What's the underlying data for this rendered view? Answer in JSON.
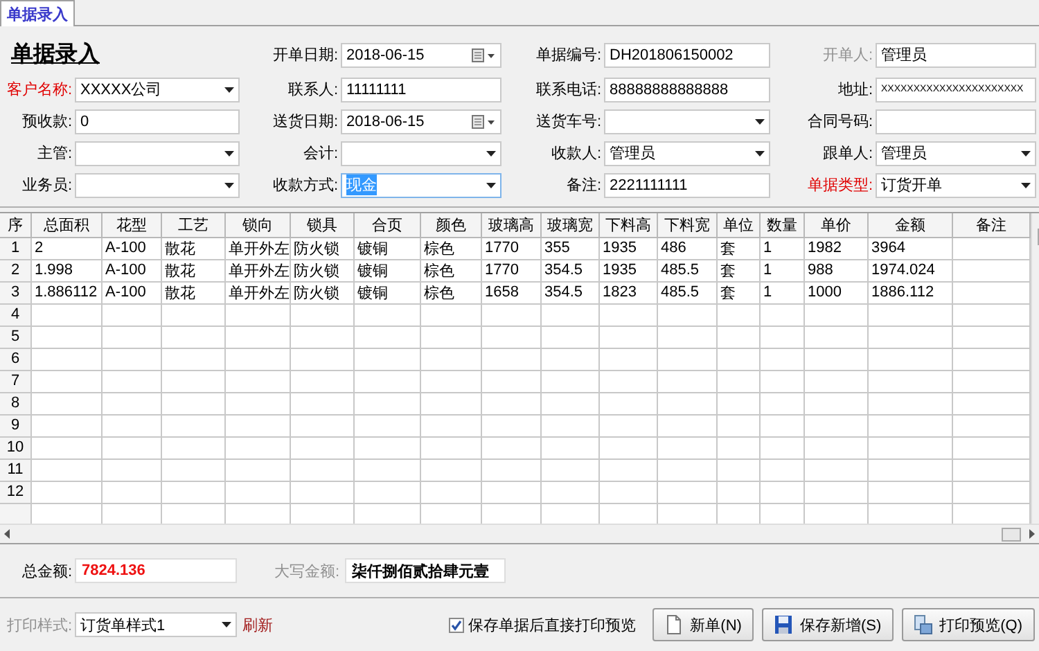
{
  "tabs": [
    {
      "label": "单据录入",
      "selected": true
    }
  ],
  "title": "单据录入",
  "header_fields": [
    {
      "label": "开单日期:",
      "kind": "date",
      "value": "2018-06-15",
      "required": false,
      "readonly": false,
      "text_highlighted": false
    },
    {
      "label": "单据编号:",
      "kind": "text",
      "value": "DH201806150002",
      "required": false,
      "readonly": false,
      "text_highlighted": false
    },
    {
      "label": "开单人:",
      "kind": "text",
      "value": "管理员",
      "required": false,
      "readonly": true,
      "text_highlighted": false
    }
  ],
  "fields": [
    {
      "label": "客户名称:",
      "kind": "combo",
      "value": "XXXXX公司",
      "required": true,
      "readonly": false,
      "text_highlighted": false
    },
    {
      "label": "联系人:",
      "kind": "text",
      "value": "11111111",
      "required": false,
      "readonly": false,
      "text_highlighted": false
    },
    {
      "label": "联系电话:",
      "kind": "text",
      "value": "88888888888888",
      "required": false,
      "readonly": false,
      "text_highlighted": false
    },
    {
      "label": "地址:",
      "kind": "text",
      "value": "XXXXXXXXXXXXXXXXXXXXXX",
      "required": false,
      "readonly": false,
      "text_highlighted": false
    },
    {
      "label": "预收款:",
      "kind": "text",
      "value": "0",
      "required": false,
      "readonly": false,
      "text_highlighted": false
    },
    {
      "label": "送货日期:",
      "kind": "date",
      "value": "2018-06-15",
      "required": false,
      "readonly": false,
      "text_highlighted": false
    },
    {
      "label": "送货车号:",
      "kind": "combo",
      "required": false,
      "readonly": false,
      "text_highlighted": false
    },
    {
      "label": "合同号码:",
      "kind": "text",
      "required": false,
      "readonly": false,
      "text_highlighted": false
    },
    {
      "label": "主管:",
      "kind": "combo",
      "required": false,
      "readonly": false,
      "text_highlighted": false
    },
    {
      "label": "会计:",
      "kind": "combo",
      "required": false,
      "readonly": false,
      "text_highlighted": false
    },
    {
      "label": "收款人:",
      "kind": "combo",
      "value": "管理员",
      "required": false,
      "readonly": false,
      "text_highlighted": false
    },
    {
      "label": "跟单人:",
      "kind": "combo",
      "value": "管理员",
      "required": false,
      "readonly": false,
      "text_highlighted": false
    },
    {
      "label": "业务员:",
      "kind": "combo",
      "required": false,
      "readonly": false,
      "text_highlighted": false
    },
    {
      "label": "收款方式:",
      "kind": "combo",
      "value": "现金",
      "required": false,
      "readonly": false,
      "text_highlighted": true
    },
    {
      "label": "备注:",
      "kind": "text",
      "value": "2221111111",
      "required": false,
      "readonly": false,
      "text_highlighted": false
    },
    {
      "label": "单据类型:",
      "kind": "combo",
      "value": "订货开单",
      "required": true,
      "readonly": false,
      "text_highlighted": false
    }
  ],
  "table": {
    "columns": [
      "序",
      "总面积",
      "花型",
      "工艺",
      "锁向",
      "锁具",
      "合页",
      "颜色",
      "玻璃高",
      "玻璃宽",
      "下料高",
      "下料宽",
      "单位",
      "数量",
      "单价",
      "金额",
      "备注"
    ],
    "rows": [
      {
        "number": "1",
        "cells": [
          "2",
          "A-100",
          "散花",
          "单开外左",
          "防火锁",
          "镀铜",
          "棕色",
          "1770",
          "355",
          "1935",
          "486",
          "套",
          "1",
          "1982",
          "3964"
        ]
      },
      {
        "number": "2",
        "cells": [
          "1.998",
          "A-100",
          "散花",
          "单开外左",
          "防火锁",
          "镀铜",
          "棕色",
          "1770",
          "354.5",
          "1935",
          "485.5",
          "套",
          "1",
          "988",
          "1974.024"
        ]
      },
      {
        "number": "3",
        "cells": [
          "1.886112",
          "A-100",
          "散花",
          "单开外左",
          "防火锁",
          "镀铜",
          "棕色",
          "1658",
          "354.5",
          "1823",
          "485.5",
          "套",
          "1",
          "1000",
          "1886.112"
        ]
      },
      {
        "number": "4"
      },
      {
        "number": "5"
      },
      {
        "number": "6"
      },
      {
        "number": "7"
      },
      {
        "number": "8"
      },
      {
        "number": "9"
      },
      {
        "number": "10"
      },
      {
        "number": "11"
      },
      {
        "number": "12"
      }
    ]
  },
  "totals": {
    "total_label": "总金额:",
    "total_value": "7824.136",
    "words_label": "大写金额:",
    "words_value": "柒仟捌佰贰拾肆元壹"
  },
  "footer": {
    "print_style_label": "打印样式:",
    "print_style_value": "订货单样式1",
    "refresh_link": "刷新",
    "auto_print": {
      "label": "保存单据后直接打印预览",
      "checked": true
    },
    "buttons": [
      {
        "label": "新单(N)",
        "kind": "new"
      },
      {
        "label": "保存新增(S)",
        "kind": "save"
      },
      {
        "label": "打印预览(Q)",
        "kind": "preview"
      }
    ]
  }
}
